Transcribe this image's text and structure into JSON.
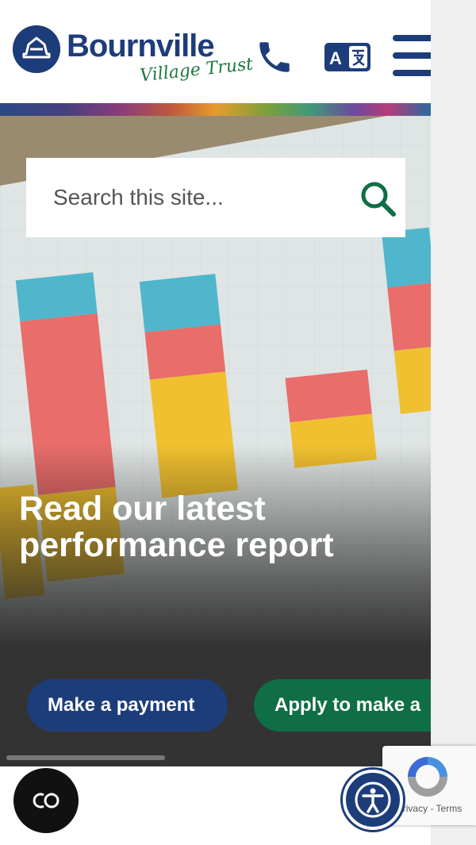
{
  "header": {
    "logo_name": "Bournville",
    "logo_tagline": "Village Trust",
    "phone_icon": "phone-icon",
    "translate_icon": "translate-icon",
    "menu_icon": "hamburger-menu-icon"
  },
  "search": {
    "placeholder": "Search this site...",
    "value": "",
    "icon": "search-icon"
  },
  "hero": {
    "title": "Read our latest performance report",
    "background": "bar-chart-photo"
  },
  "actions": {
    "items": [
      {
        "label": "Make a payment"
      },
      {
        "label": "Apply to make a"
      }
    ]
  },
  "floating": {
    "cookie_label": "CO",
    "accessibility_icon": "accessibility-icon",
    "recaptcha_links": "Privacy - Terms"
  },
  "colors": {
    "brand_navy": "#1d3d7a",
    "brand_green": "#0f6e45",
    "action_strip": "#333333"
  }
}
